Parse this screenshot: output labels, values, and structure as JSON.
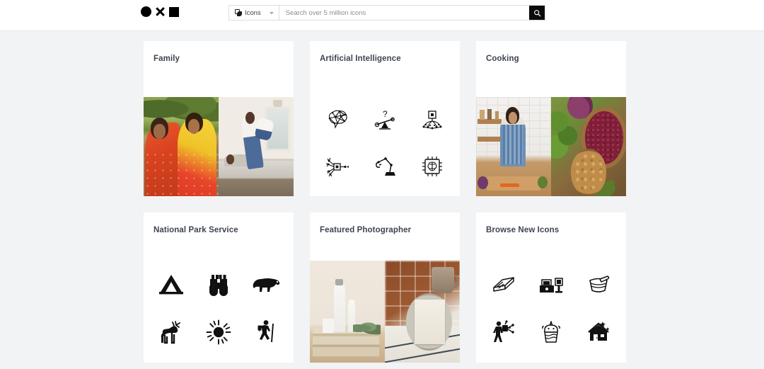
{
  "header": {
    "logo": {
      "shapes": [
        "circle",
        "x",
        "square"
      ]
    },
    "search": {
      "type_icon": "layers-icon",
      "type_label": "Icons",
      "chevron_icon": "chevron-down-icon",
      "placeholder": "Search over 5 million icons",
      "value": "",
      "submit_icon": "search-icon"
    }
  },
  "cards": [
    {
      "title": "Family",
      "kind": "photos",
      "photos": [
        "two-women-in-saris-in-park",
        "father-lifting-child-on-bed"
      ]
    },
    {
      "title": "Artificial Intelligence",
      "kind": "icons",
      "icons": [
        "brain-network-icon",
        "question-balance-scale-icon",
        "chip-neural-net-icon",
        "neural-network-node-icon",
        "robotic-arm-icon",
        "cpu-brain-icon"
      ]
    },
    {
      "title": "Cooking",
      "kind": "photos",
      "photos": [
        "woman-chopping-vegetables-in-kitchen",
        "bowl-of-red-beans-and-walnuts"
      ]
    },
    {
      "title": "National Park Service",
      "kind": "icons",
      "icons": [
        "tent-icon",
        "binoculars-icon",
        "bear-icon",
        "deer-icon",
        "sun-icon",
        "hiker-icon"
      ]
    },
    {
      "title": "Featured Photographer",
      "kind": "photos",
      "photos": [
        "cosmetic-bottles-on-stacked-books",
        "mug-and-notebook-flat-lay"
      ]
    },
    {
      "title": "Browse New Icons",
      "kind": "icons",
      "icons": [
        "open-book-pages-icon",
        "printer-desk-icon",
        "bowl-with-spoon-icon",
        "person-with-backpack-icon",
        "unicorn-cupcake-icon",
        "house-with-stars-icon"
      ]
    }
  ],
  "colors": {
    "page_background": "#f2f3f5",
    "card_background": "#ffffff",
    "title_text": "#3d4451",
    "accent_button": "#0b0b0b",
    "border": "#dcdde0"
  }
}
